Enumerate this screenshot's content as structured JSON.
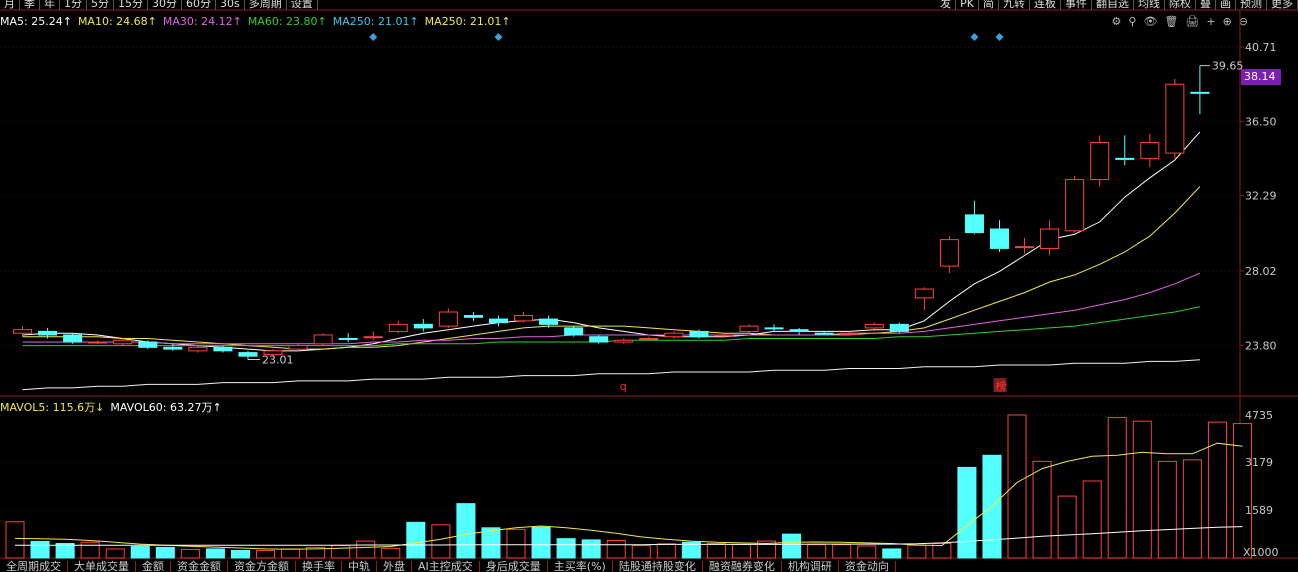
{
  "toolbar": {
    "left": [
      "月",
      "季",
      "年",
      "1分",
      "5分",
      "15分",
      "30分",
      "60分",
      "30s",
      "多周期",
      "设置"
    ],
    "right": [
      "发",
      "PK",
      "简",
      "九转",
      "连板",
      "事件",
      "翻自选",
      "均线",
      "除权",
      "叠",
      "画",
      "预测",
      "更多"
    ]
  },
  "ma_legend": [
    {
      "label": "MA5: 25.24↑",
      "color": "#ffffff"
    },
    {
      "label": "MA10: 24.68↑",
      "color": "#f2e84a"
    },
    {
      "label": "MA30: 24.12↑",
      "color": "#e066e0"
    },
    {
      "label": "MA60: 23.80↑",
      "color": "#2ed02e"
    },
    {
      "label": "MA250: 21.01↑",
      "color": "#3ec7e8"
    },
    {
      "label": "MA250: 21.01↑",
      "color": "#f2e84a"
    }
  ],
  "vol_legend": [
    {
      "label": "MAVOL5: 115.6万↓",
      "color": "#f2e84a"
    },
    {
      "label": "MAVOL60: 63.27万↑",
      "color": "#ffffff"
    }
  ],
  "right_icons": [
    "⚙",
    "⚲",
    "👁",
    "🗑",
    "🖨",
    "+",
    "⊕",
    "⊖"
  ],
  "price_tag": "38.14",
  "bottom_tabs": [
    "全周期成交",
    "大单成交量",
    "金额",
    "资金金额",
    "资金方金额",
    "换手率",
    "中轨",
    "外盘",
    "AI主控成交",
    "身后成交量",
    "主买率(%)",
    "陆股通持股变化",
    "融资融券变化",
    "机构调研",
    "资金动向"
  ],
  "colors": {
    "up": "#ff4040",
    "down": "#54ffff",
    "axis": "#8b1a1a",
    "grid": "#3a0d0d",
    "axis_text": "#c8c8c8"
  },
  "chart_data": [
    {
      "type": "candlestick",
      "ylim": [
        21.0,
        41.5
      ],
      "yticks": [
        40.71,
        36.5,
        32.29,
        28.02,
        23.8
      ],
      "high_label": "39.65",
      "low_label": "23.01",
      "markers": [
        {
          "text": "q",
          "color": "#ff3030",
          "index": 24
        },
        {
          "text": "榜",
          "color": "#ff3030",
          "index": 39
        }
      ],
      "diamond_indices": [
        14,
        19,
        38,
        39
      ],
      "candles": [
        {
          "o": 24.5,
          "c": 24.7,
          "h": 24.9,
          "l": 24.3
        },
        {
          "o": 24.6,
          "c": 24.4,
          "h": 24.8,
          "l": 24.2
        },
        {
          "o": 24.4,
          "c": 24.0,
          "h": 24.5,
          "l": 23.9
        },
        {
          "o": 24.0,
          "c": 24.0,
          "h": 24.1,
          "l": 23.9
        },
        {
          "o": 23.9,
          "c": 24.1,
          "h": 24.2,
          "l": 23.8
        },
        {
          "o": 24.0,
          "c": 23.7,
          "h": 24.1,
          "l": 23.6
        },
        {
          "o": 23.7,
          "c": 23.6,
          "h": 23.9,
          "l": 23.5
        },
        {
          "o": 23.5,
          "c": 23.7,
          "h": 23.8,
          "l": 23.4
        },
        {
          "o": 23.7,
          "c": 23.5,
          "h": 23.8,
          "l": 23.4
        },
        {
          "o": 23.4,
          "c": 23.2,
          "h": 23.5,
          "l": 23.01
        },
        {
          "o": 23.3,
          "c": 23.5,
          "h": 23.6,
          "l": 23.2
        },
        {
          "o": 23.6,
          "c": 23.8,
          "h": 23.9,
          "l": 23.5
        },
        {
          "o": 23.9,
          "c": 24.4,
          "h": 24.5,
          "l": 23.8
        },
        {
          "o": 24.2,
          "c": 24.2,
          "h": 24.5,
          "l": 24.0
        },
        {
          "o": 24.3,
          "c": 24.3,
          "h": 24.6,
          "l": 24.1
        },
        {
          "o": 24.6,
          "c": 25.0,
          "h": 25.2,
          "l": 24.5
        },
        {
          "o": 25.0,
          "c": 24.8,
          "h": 25.3,
          "l": 24.6
        },
        {
          "o": 24.9,
          "c": 25.7,
          "h": 25.9,
          "l": 24.8
        },
        {
          "o": 25.5,
          "c": 25.4,
          "h": 25.7,
          "l": 25.2
        },
        {
          "o": 25.3,
          "c": 25.1,
          "h": 25.5,
          "l": 24.9
        },
        {
          "o": 25.2,
          "c": 25.5,
          "h": 25.7,
          "l": 25.1
        },
        {
          "o": 25.3,
          "c": 25.0,
          "h": 25.5,
          "l": 24.8
        },
        {
          "o": 24.8,
          "c": 24.4,
          "h": 24.9,
          "l": 24.3
        },
        {
          "o": 24.3,
          "c": 24.0,
          "h": 24.4,
          "l": 23.9
        },
        {
          "o": 24.0,
          "c": 24.1,
          "h": 24.2,
          "l": 23.9
        },
        {
          "o": 24.2,
          "c": 24.2,
          "h": 24.3,
          "l": 24.1
        },
        {
          "o": 24.3,
          "c": 24.5,
          "h": 24.6,
          "l": 24.2
        },
        {
          "o": 24.6,
          "c": 24.3,
          "h": 24.7,
          "l": 24.2
        },
        {
          "o": 24.4,
          "c": 24.4,
          "h": 24.5,
          "l": 24.3
        },
        {
          "o": 24.6,
          "c": 24.9,
          "h": 25.0,
          "l": 24.5
        },
        {
          "o": 24.8,
          "c": 24.8,
          "h": 25.0,
          "l": 24.6
        },
        {
          "o": 24.7,
          "c": 24.6,
          "h": 24.8,
          "l": 24.4
        },
        {
          "o": 24.5,
          "c": 24.5,
          "h": 24.6,
          "l": 24.4
        },
        {
          "o": 24.5,
          "c": 24.5,
          "h": 24.6,
          "l": 24.4
        },
        {
          "o": 24.8,
          "c": 25.0,
          "h": 25.1,
          "l": 24.6
        },
        {
          "o": 25.0,
          "c": 24.6,
          "h": 25.1,
          "l": 24.5
        },
        {
          "o": 26.5,
          "c": 27.0,
          "h": 27.1,
          "l": 25.8
        },
        {
          "o": 28.3,
          "c": 29.8,
          "h": 30.0,
          "l": 27.9
        },
        {
          "o": 31.2,
          "c": 30.2,
          "h": 32.0,
          "l": 30.1
        },
        {
          "o": 30.4,
          "c": 29.3,
          "h": 30.9,
          "l": 29.1
        },
        {
          "o": 29.4,
          "c": 29.4,
          "h": 29.9,
          "l": 29.0
        },
        {
          "o": 29.3,
          "c": 30.4,
          "h": 30.9,
          "l": 28.9
        },
        {
          "o": 30.3,
          "c": 33.2,
          "h": 33.4,
          "l": 30.2
        },
        {
          "o": 33.2,
          "c": 35.3,
          "h": 35.7,
          "l": 32.8
        },
        {
          "o": 34.4,
          "c": 34.4,
          "h": 35.7,
          "l": 34.0
        },
        {
          "o": 34.4,
          "c": 35.3,
          "h": 35.8,
          "l": 33.9
        },
        {
          "o": 34.7,
          "c": 38.6,
          "h": 38.9,
          "l": 34.4
        },
        {
          "o": 38.14,
          "c": 38.14,
          "h": 39.65,
          "l": 36.9
        }
      ],
      "ma_lines": [
        {
          "name": "MA5",
          "color": "#ffffff",
          "values": [
            24.4,
            24.5,
            24.5,
            24.4,
            24.2,
            24.0,
            23.9,
            23.8,
            23.7,
            23.6,
            23.5,
            23.5,
            23.6,
            23.7,
            23.9,
            24.2,
            24.5,
            24.7,
            24.9,
            25.1,
            25.2,
            25.3,
            25.1,
            24.8,
            24.6,
            24.4,
            24.3,
            24.3,
            24.3,
            24.4,
            24.6,
            24.6,
            24.6,
            24.6,
            24.7,
            24.7,
            25.2,
            26.3,
            27.3,
            28.0,
            28.9,
            29.8,
            30.1,
            30.8,
            32.2,
            33.3,
            34.3,
            35.9
          ]
        },
        {
          "name": "MA10",
          "color": "#f2e84a",
          "values": [
            24.3,
            24.3,
            24.3,
            24.3,
            24.2,
            24.2,
            24.1,
            24.0,
            23.9,
            23.8,
            23.7,
            23.6,
            23.6,
            23.7,
            23.7,
            23.8,
            24.0,
            24.2,
            24.4,
            24.6,
            24.8,
            24.9,
            24.9,
            24.9,
            24.9,
            24.8,
            24.7,
            24.6,
            24.5,
            24.5,
            24.4,
            24.4,
            24.4,
            24.5,
            24.5,
            24.6,
            24.8,
            25.3,
            25.8,
            26.3,
            26.8,
            27.4,
            27.8,
            28.4,
            29.1,
            30.0,
            31.3,
            32.8
          ]
        },
        {
          "name": "MA30",
          "color": "#e066e0",
          "values": [
            24.0,
            24.0,
            24.0,
            24.0,
            24.0,
            24.0,
            23.9,
            23.9,
            23.9,
            23.9,
            23.9,
            23.9,
            23.9,
            23.9,
            24.0,
            24.0,
            24.1,
            24.1,
            24.2,
            24.2,
            24.3,
            24.3,
            24.4,
            24.4,
            24.4,
            24.4,
            24.4,
            24.4,
            24.4,
            24.4,
            24.4,
            24.4,
            24.4,
            24.4,
            24.5,
            24.5,
            24.6,
            24.8,
            25.0,
            25.2,
            25.4,
            25.6,
            25.8,
            26.1,
            26.4,
            26.8,
            27.3,
            27.9
          ]
        },
        {
          "name": "MA60",
          "color": "#2ed02e",
          "values": [
            23.8,
            23.8,
            23.8,
            23.8,
            23.8,
            23.8,
            23.8,
            23.8,
            23.8,
            23.8,
            23.8,
            23.8,
            23.8,
            23.8,
            23.8,
            23.9,
            23.9,
            23.9,
            23.9,
            24.0,
            24.0,
            24.0,
            24.0,
            24.0,
            24.1,
            24.1,
            24.1,
            24.1,
            24.1,
            24.2,
            24.2,
            24.2,
            24.2,
            24.2,
            24.2,
            24.3,
            24.3,
            24.4,
            24.5,
            24.6,
            24.7,
            24.8,
            24.9,
            25.1,
            25.3,
            25.5,
            25.7,
            26.0
          ]
        },
        {
          "name": "MA250",
          "color": "#f2f2f2",
          "values": [
            21.3,
            21.4,
            21.4,
            21.5,
            21.5,
            21.6,
            21.6,
            21.6,
            21.7,
            21.7,
            21.7,
            21.8,
            21.8,
            21.8,
            21.9,
            21.9,
            21.9,
            22.0,
            22.0,
            22.0,
            22.1,
            22.1,
            22.1,
            22.2,
            22.2,
            22.2,
            22.3,
            22.3,
            22.3,
            22.3,
            22.4,
            22.4,
            22.4,
            22.5,
            22.5,
            22.5,
            22.6,
            22.6,
            22.6,
            22.7,
            22.7,
            22.7,
            22.8,
            22.8,
            22.8,
            22.9,
            22.9,
            23.0
          ]
        }
      ]
    },
    {
      "type": "bar",
      "unit": "万",
      "ylim": [
        0,
        4735
      ],
      "yticks": [
        4735,
        3179,
        1589
      ],
      "axis_unit_label": "X1000",
      "volumes": [
        1200,
        550,
        480,
        520,
        300,
        380,
        350,
        280,
        300,
        250,
        250,
        300,
        350,
        420,
        560,
        320,
        1180,
        1100,
        1800,
        1000,
        950,
        1020,
        640,
        600,
        580,
        410,
        470,
        520,
        480,
        450,
        560,
        790,
        440,
        440,
        400,
        300,
        420,
        480,
        3000,
        3400,
        4735,
        3200,
        2050,
        2550,
        4650,
        4530,
        3200,
        3250,
        4500,
        4450
      ],
      "mavol5": [
        650,
        640,
        620,
        580,
        520,
        460,
        420,
        390,
        360,
        330,
        300,
        290,
        300,
        320,
        350,
        380,
        500,
        620,
        780,
        900,
        1000,
        1060,
        1000,
        920,
        820,
        700,
        620,
        560,
        520,
        500,
        480,
        520,
        530,
        520,
        500,
        480,
        430,
        410,
        1070,
        1720,
        2500,
        2960,
        3200,
        3370,
        3400,
        3500,
        3450,
        3450,
        3800,
        3700
      ],
      "mavol60": [
        420,
        420,
        420,
        420,
        420,
        420,
        420,
        420,
        420,
        420,
        420,
        420,
        420,
        420,
        430,
        430,
        430,
        430,
        440,
        440,
        440,
        440,
        440,
        440,
        440,
        440,
        450,
        450,
        450,
        450,
        450,
        450,
        460,
        460,
        460,
        460,
        470,
        500,
        550,
        600,
        660,
        720,
        760,
        800,
        850,
        900,
        940,
        980,
        1020,
        1040
      ]
    }
  ]
}
